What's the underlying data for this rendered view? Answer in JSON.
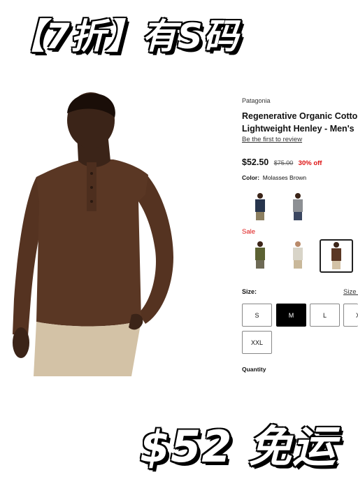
{
  "banner": {
    "top": "【7折】有S码",
    "bottom": "$52 免运"
  },
  "product": {
    "brand": "Patagonia",
    "title_line1": "Regenerative Organic Cotton",
    "title_line2": "Lightweight Henley - Men's",
    "review_link": "Be the first to review",
    "price": "$52.50",
    "original_price": "$75.00",
    "discount": "30% off"
  },
  "color": {
    "label": "Color:",
    "value": "Molasses Brown"
  },
  "swatches": [
    {
      "name": "navy",
      "shirt": "#27354d",
      "pants": "#8c7f60"
    },
    {
      "name": "gray",
      "shirt": "#8d9094",
      "pants": "#3a4660"
    },
    {
      "name": "olive",
      "shirt": "#5c6233",
      "pants": "#6e6a55"
    },
    {
      "name": "natural",
      "shirt": "#d8d4c8",
      "pants": "#c9b89a"
    },
    {
      "name": "molasses-brown",
      "shirt": "#5a3724",
      "pants": "#d3c2a6"
    }
  ],
  "sale_label": "Sale",
  "sizes": {
    "label": "Size:",
    "guide": "Size G",
    "options": [
      "S",
      "M",
      "L",
      "XL",
      "XXL"
    ],
    "selected": "M"
  },
  "quantity_label": "Quantity",
  "colors": {
    "shirt": "#5a3724",
    "pants": "#d3c2a6",
    "skin": "#3b2418",
    "sale": "#dd1111"
  }
}
